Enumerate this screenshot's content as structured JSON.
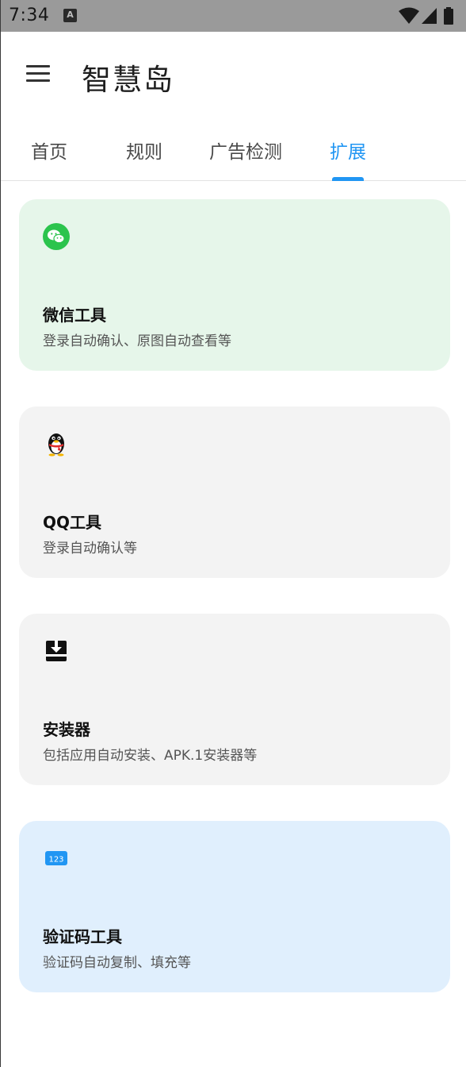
{
  "status_bar": {
    "time": "7:34",
    "notification_glyph": "A",
    "icons": [
      "wifi-icon",
      "cell-signal-icon",
      "battery-icon"
    ]
  },
  "app_bar": {
    "title": "智慧岛",
    "menu_icon": "menu-icon"
  },
  "tabs": {
    "items": [
      {
        "label": "首页"
      },
      {
        "label": "规则"
      },
      {
        "label": "广告检测"
      },
      {
        "label": "扩展"
      }
    ],
    "active_label": "扩展",
    "active_color": "#2196f3"
  },
  "cards": [
    {
      "icon": "wechat-icon",
      "title": "微信工具",
      "description": "登录自动确认、原图自动查看等",
      "background": "#e6f6ea"
    },
    {
      "icon": "qq-penguin-icon",
      "title": "QQ工具",
      "description": "登录自动确认等",
      "background": "#f3f3f3"
    },
    {
      "icon": "installer-download-icon",
      "title": "安装器",
      "description": "包括应用自动安装、APK.1安装器等",
      "background": "#f3f3f3"
    },
    {
      "icon": "verification-code-icon",
      "icon_text": "123",
      "title": "验证码工具",
      "description": "验证码自动复制、填充等",
      "background": "#e0effd"
    }
  ]
}
